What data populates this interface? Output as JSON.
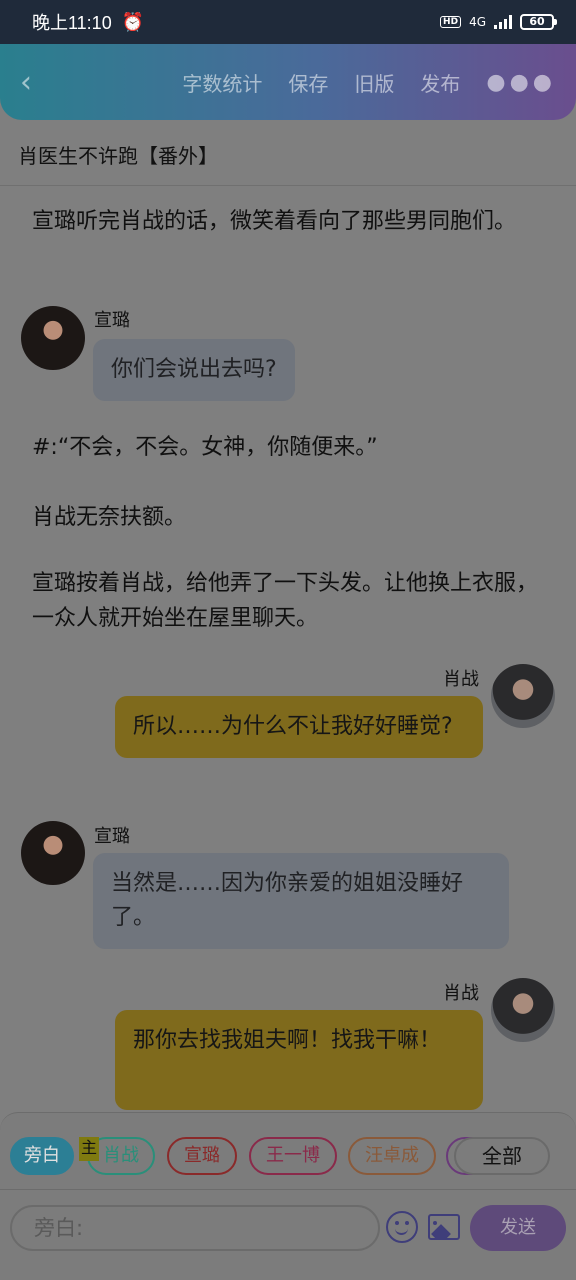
{
  "status_bar": {
    "time": "晚上11:10",
    "network": "4G",
    "battery": "60"
  },
  "header": {
    "back_icon": "chevron-left-icon",
    "actions": [
      "字数统计",
      "保存",
      "旧版",
      "发布"
    ],
    "more_icon": "more-dots-icon"
  },
  "chapter_title": "肖医生不许跑【番外】",
  "messages": [
    {
      "type": "narration",
      "text": "宣璐听完肖战的话，微笑着看向了那些男同胞们。"
    },
    {
      "type": "dialog",
      "side": "left",
      "speaker": "宣璐",
      "text": "你们会说出去吗?"
    },
    {
      "type": "narration",
      "text": "#:“不会，不会。女神，你随便来。”"
    },
    {
      "type": "narration",
      "text": "肖战无奈扶额。"
    },
    {
      "type": "narration",
      "text": "宣璐按着肖战，给他弄了一下头发。让他换上衣服，一众人就开始坐在屋里聊天。"
    },
    {
      "type": "dialog",
      "side": "right",
      "speaker": "肖战",
      "text": "所以……为什么不让我好好睡觉?"
    },
    {
      "type": "dialog",
      "side": "left",
      "speaker": "宣璐",
      "text": "当然是……因为你亲爱的姐姐没睡好了。"
    },
    {
      "type": "dialog",
      "side": "right",
      "speaker": "肖战",
      "text": "那你去找我姐夫啊！找我干嘛！"
    }
  ],
  "role_chips": [
    {
      "label": "旁白",
      "selected": true
    },
    {
      "label": "肖战",
      "badge": "主",
      "color": "#2a8f7a"
    },
    {
      "label": "宣璐",
      "color": "#8a2a2a"
    },
    {
      "label": "王一博",
      "color": "#8a2a4a"
    },
    {
      "label": "汪卓成",
      "color": "#8a5a3a"
    }
  ],
  "all_chip": "全部",
  "input": {
    "placeholder": "旁白:"
  },
  "send_label": "发送",
  "colors": {
    "header_start": "#2a7f8e",
    "header_end": "#6a4e8e",
    "left_bubble": "#70757d",
    "right_bubble": "#7f6a1c",
    "send_button": "#5e4a7a"
  }
}
